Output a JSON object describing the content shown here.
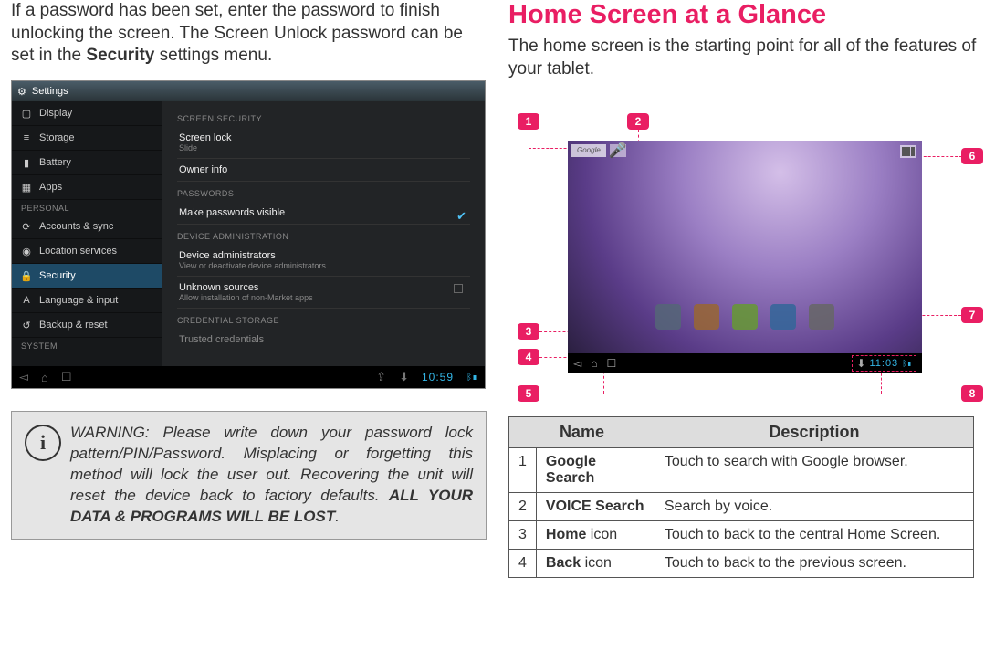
{
  "left": {
    "intro_a": "If a password has been set, enter the password to finish unlocking the screen. The Screen Unlock password can be set in the ",
    "intro_b": "Security",
    "intro_c": " settings menu.",
    "settings": {
      "title": "Settings",
      "sidebar": {
        "items": [
          {
            "icon": "▢",
            "label": "Display"
          },
          {
            "icon": "≡",
            "label": "Storage"
          },
          {
            "icon": "▮",
            "label": "Battery"
          },
          {
            "icon": "▦",
            "label": "Apps"
          }
        ],
        "personal_header": "PERSONAL",
        "personal": [
          {
            "icon": "⟳",
            "label": "Accounts & sync"
          },
          {
            "icon": "◉",
            "label": "Location services"
          },
          {
            "icon": "🔒",
            "label": "Security",
            "selected": true
          },
          {
            "icon": "A",
            "label": "Language & input"
          },
          {
            "icon": "↺",
            "label": "Backup & reset"
          }
        ],
        "system_header": "SYSTEM"
      },
      "pane": {
        "s1": "SCREEN SECURITY",
        "r1t": "Screen lock",
        "r1s": "Slide",
        "r2": "Owner info",
        "s2": "PASSWORDS",
        "r3": "Make passwords visible",
        "s3": "DEVICE ADMINISTRATION",
        "r4t": "Device administrators",
        "r4s": "View or deactivate device administrators",
        "r5t": "Unknown sources",
        "r5s": "Allow installation of non-Market apps",
        "s4": "CREDENTIAL STORAGE",
        "r6": "Trusted credentials"
      },
      "time": "10:59"
    },
    "warning": {
      "p1": "WARNING: Please write down your password lock pattern/PIN/Password. Misplacing or forgetting this method will lock the user out. Recovering the unit will reset the device back to factory defaults. ",
      "p2": "ALL YOUR DATA & PROGRAMS WILL BE LOST",
      "p3": "."
    }
  },
  "right": {
    "heading": "Home Screen at a Glance",
    "intro": "The home screen is the starting point for all of the features of your tablet.",
    "callouts": {
      "c1": "1",
      "c2": "2",
      "c3": "3",
      "c4": "4",
      "c5": "5",
      "c6": "6",
      "c7": "7",
      "c8": "8"
    },
    "tablet": {
      "google": "Google",
      "time": "11:03"
    },
    "table": {
      "h1": "Name",
      "h2": "Description",
      "rows": [
        {
          "n": "1",
          "name_b": "Google Search",
          "name_r": "",
          "desc": "Touch to search with Google browser."
        },
        {
          "n": "2",
          "name_b": "VOICE Search",
          "name_r": "",
          "desc": "Search by voice."
        },
        {
          "n": "3",
          "name_b": "Home",
          "name_r": " icon",
          "desc": "Touch to back to the central Home Screen."
        },
        {
          "n": "4",
          "name_b": "Back",
          "name_r": " icon",
          "desc": "Touch to back to the previous screen."
        }
      ]
    }
  }
}
